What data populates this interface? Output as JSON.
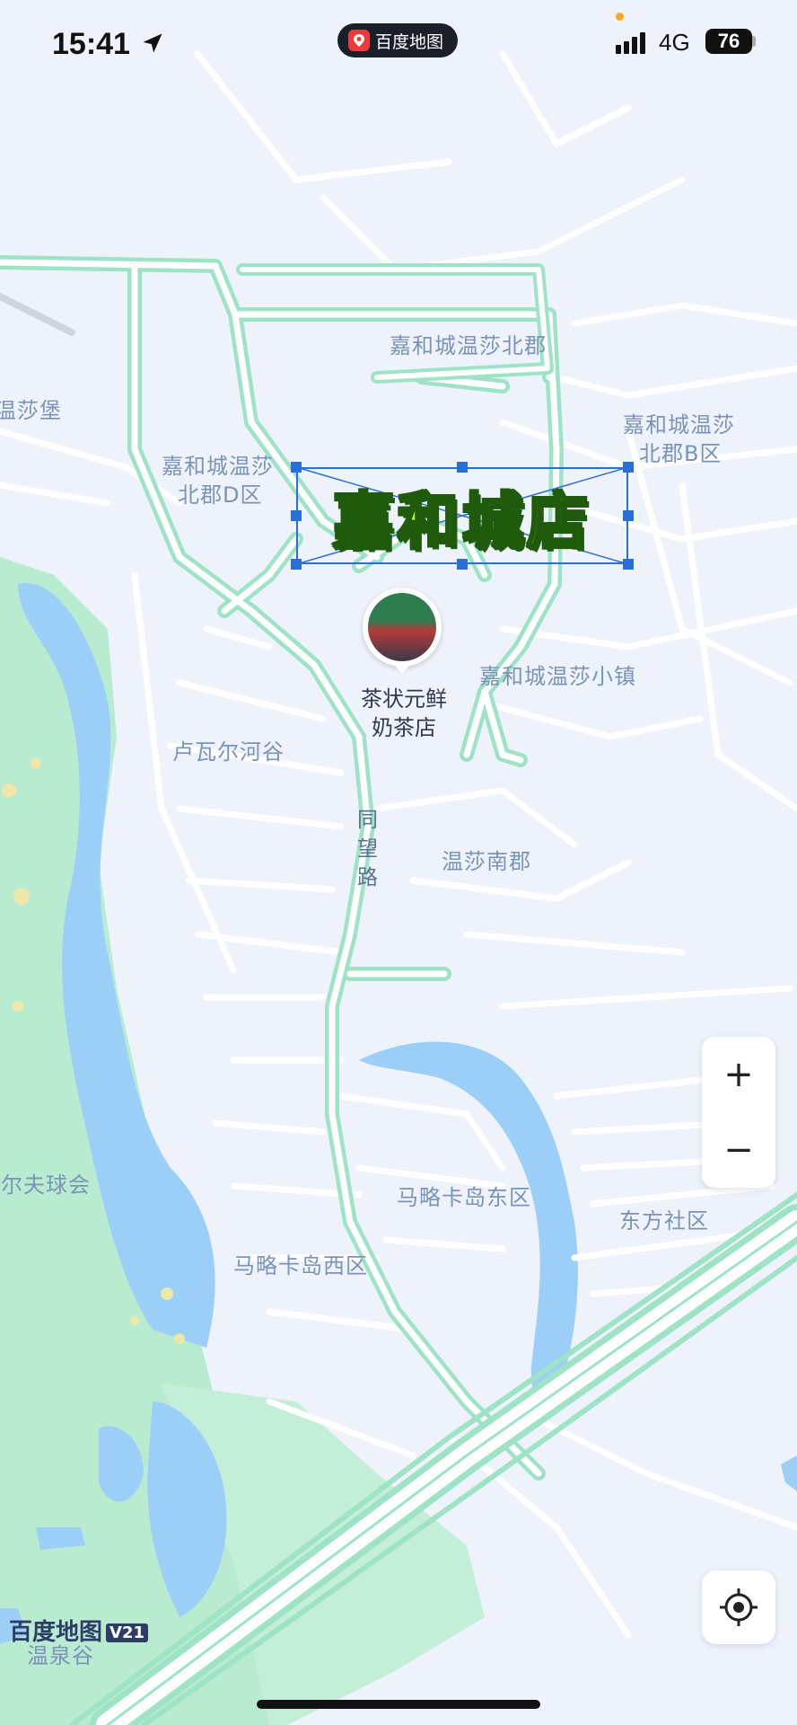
{
  "status_bar": {
    "time": "15:41",
    "app_name": "百度地图",
    "network": "4G",
    "battery": "76"
  },
  "banner": {
    "text": "嘉和城店"
  },
  "poi": {
    "name_line1": "茶状元鲜",
    "name_line2": "奶茶店"
  },
  "map_labels": {
    "north_jun": "嘉和城温莎北郡",
    "bei_b_line1": "嘉和城温莎",
    "bei_b_line2": "北郡B区",
    "bei_d_line1": "嘉和城温莎",
    "bei_d_line2": "北郡D区",
    "wensha_bao": "温莎堡",
    "xiaozhen": "嘉和城温莎小镇",
    "luwa": "卢瓦尔河谷",
    "road_1": "同",
    "road_2": "望",
    "road_3": "路",
    "nanjun": "温莎南郡",
    "golf": "高尔夫球会",
    "malue_east": "马略卡岛东区",
    "dongfang": "东方社区",
    "malue_west": "马略卡岛西区",
    "hot_spring": "温泉谷"
  },
  "watermark": {
    "text": "百度地图",
    "version": "V21"
  },
  "controls": {
    "zoom_in": "+",
    "zoom_out": "−"
  },
  "colors": {
    "map_bg": "#eef3fb",
    "road_main": "#9fe3c6",
    "water": "#9ccff8",
    "park": "#b8ebcf",
    "handle": "#2a6fd6",
    "banner_fill": "#b5f53a"
  },
  "icons": {
    "location_arrow": "location-arrow-icon",
    "locate": "crosshair-icon",
    "signal": "signal-bars-icon"
  }
}
